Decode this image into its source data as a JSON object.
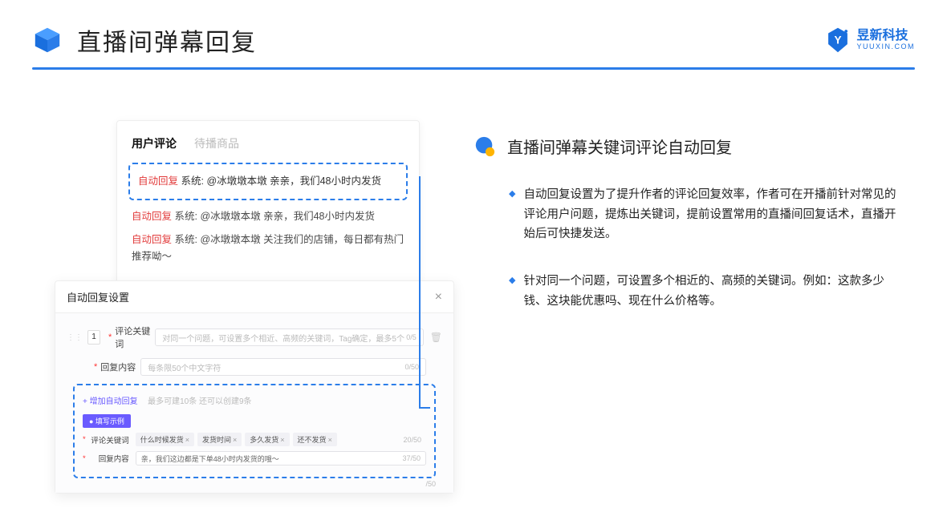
{
  "header": {
    "title": "直播间弹幕回复"
  },
  "brand": {
    "cn": "昱新科技",
    "en": "YUUXIN.COM"
  },
  "right": {
    "section_title": "直播间弹幕关键词评论自动回复",
    "bullets": [
      "自动回复设置为了提升作者的评论回复效率，作者可在开播前针对常见的评论用户问题，提炼出关键词，提前设置常用的直播间回复话术，直播开始后可快捷发送。",
      "针对同一个问题，可设置多个相近的、高频的关键词。例如：这款多少钱、这块能优惠吗、现在什么价格等。"
    ]
  },
  "comments_card": {
    "tab_active": "用户评论",
    "tab_inactive": "待播商品",
    "highlighted": {
      "tag": "自动回复",
      "text": "系统: @冰墩墩本墩 亲亲，我们48小时内发货"
    },
    "lines": [
      {
        "tag": "自动回复",
        "text": "系统: @冰墩墩本墩 亲亲，我们48小时内发货"
      },
      {
        "tag": "自动回复",
        "text": "系统: @冰墩墩本墩 关注我们的店铺，每日都有热门推荐呦～"
      }
    ]
  },
  "settings_card": {
    "title": "自动回复设置",
    "num": "1",
    "kw_label": "评论关键词",
    "kw_placeholder": "对同一个问题，可设置多个相近、高频的关键词，Tag确定，最多5个",
    "kw_counter": "0/5",
    "reply_label": "回复内容",
    "reply_placeholder": "每条限50个中文字符",
    "reply_counter": "0/50",
    "add_link": "+ 增加自动回复",
    "add_hint": "最多可建10条 还可以创建9条",
    "example_badge": "● 填写示例",
    "ex_kw_label": "评论关键词",
    "ex_tags": [
      "什么时候发货",
      "发货时间",
      "多久发货",
      "还不发货"
    ],
    "ex_kw_counter": "20/50",
    "ex_reply_label": "回复内容",
    "ex_reply_value": "亲，我们这边都是下单48小时内发货的哦～",
    "ex_reply_counter": "37/50",
    "stray_counter": "/50"
  }
}
